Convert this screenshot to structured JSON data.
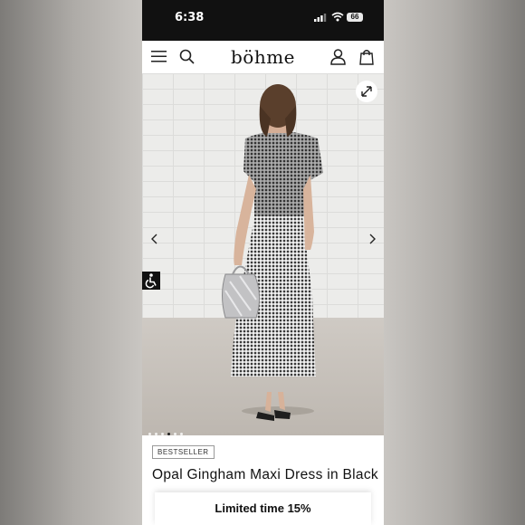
{
  "status_bar": {
    "time": "6:38",
    "battery": "66"
  },
  "nav": {
    "menu_icon": "hamburger-menu-icon",
    "search_icon": "search-icon",
    "logo": "böhme",
    "account_icon": "user-icon",
    "cart_icon": "shopping-bag-icon"
  },
  "gallery": {
    "expand_icon": "expand-icon",
    "prev_icon": "chevron-left-icon",
    "next_icon": "chevron-right-icon",
    "dot_count": 6,
    "active_dot": 3
  },
  "accessibility_icon": "wheelchair-icon",
  "product": {
    "badge": "BESTSELLER",
    "title": "Opal Gingham Maxi Dress in Black"
  },
  "promo_banner": {
    "text": "Limited time 15%"
  }
}
